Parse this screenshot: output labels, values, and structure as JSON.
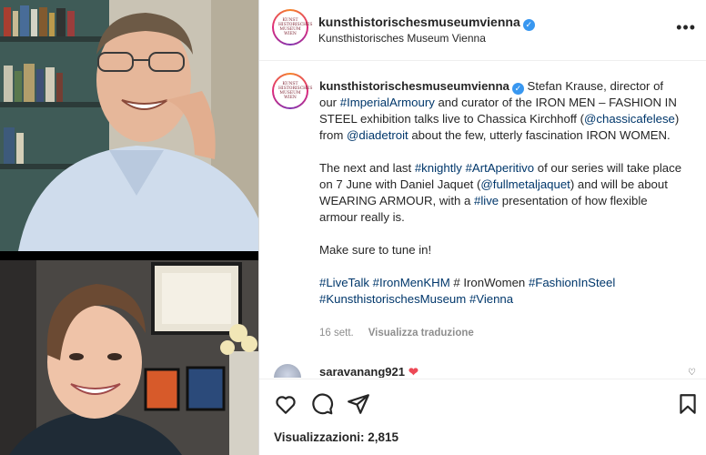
{
  "post": {
    "author": "kunsthistorischesmuseumvienna",
    "author_fullname": "Kunsthistorisches Museum Vienna",
    "logo_text": "KUNST HISTORISCHES MUSEUM WIEN",
    "caption": {
      "p1": [
        {
          "t": " Stefan Krause, director of our "
        },
        {
          "t": "#ImperialArmoury",
          "link": true
        },
        {
          "t": " and curator of the IRON MEN – FASHION IN STEEL exhibition talks live to Chassica Kirchhoff ("
        },
        {
          "t": "@chassicafelese",
          "link": true
        },
        {
          "t": ") from "
        },
        {
          "t": "@diadetroit",
          "link": true
        },
        {
          "t": " about the few, utterly fascination IRON WOMEN."
        }
      ],
      "p2": [
        {
          "t": "The next and last "
        },
        {
          "t": "#knightly",
          "link": true
        },
        {
          "t": " "
        },
        {
          "t": "#ArtAperitivo",
          "link": true
        },
        {
          "t": " of our series will take place on 7 June with Daniel Jaquet ("
        },
        {
          "t": "@fullmetaljaquet",
          "link": true
        },
        {
          "t": ") and will be about WEARING ARMOUR, with a "
        },
        {
          "t": "#live",
          "link": true
        },
        {
          "t": " presentation of how flexible armour really is."
        }
      ],
      "p3": [
        {
          "t": "Make sure to tune in!"
        }
      ],
      "p4": [
        {
          "t": "#LiveTalk",
          "link": true
        },
        {
          "t": " "
        },
        {
          "t": "#IronMenKHM",
          "link": true
        },
        {
          "t": " # IronWomen "
        },
        {
          "t": "#FashionInSteel",
          "link": true
        },
        {
          "t": " "
        },
        {
          "t": "#KunsthistorischesMuseum",
          "link": true
        },
        {
          "t": " "
        },
        {
          "t": "#Vienna",
          "link": true
        }
      ]
    },
    "time_ago": "16 sett.",
    "translate_label": "Visualizza traduzione",
    "next_comment_user": "saravanang921",
    "views_label": "Visualizzazioni: 2,815"
  },
  "colors": {
    "link": "#00376b",
    "verified": "#3897f0",
    "heart": "#ed4956"
  },
  "icons": [
    "more-icon",
    "verified-icon",
    "like-icon",
    "comment-icon",
    "share-icon",
    "bookmark-icon"
  ]
}
